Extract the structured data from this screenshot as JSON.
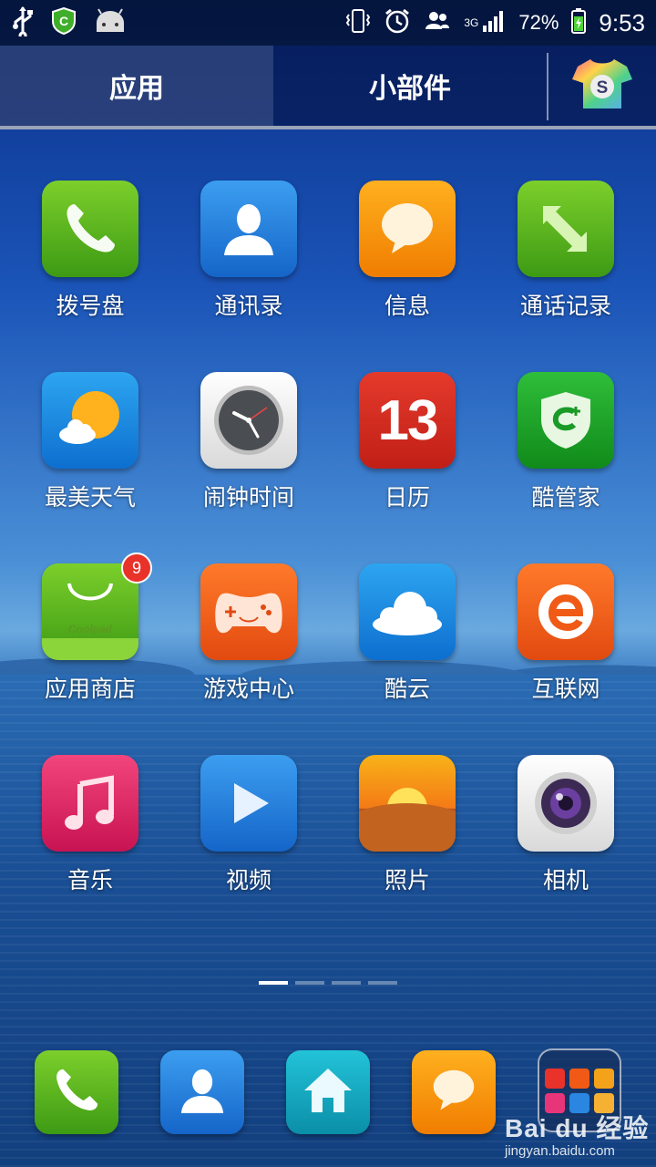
{
  "status_bar": {
    "network_type": "3G",
    "battery": "72%",
    "time": "9:53",
    "icons": [
      "usb-icon",
      "security-shield-icon",
      "android-icon",
      "vibrate-icon",
      "alarm-icon",
      "contacts-sync-icon",
      "signal-icon",
      "battery-icon"
    ]
  },
  "tabs": [
    {
      "label": "应用",
      "active": true
    },
    {
      "label": "小部件",
      "active": false
    }
  ],
  "theme_button": {
    "icon": "theme-shirt-icon",
    "letter": "S"
  },
  "apps": [
    {
      "label": "拨号盘",
      "icon": "phone-icon"
    },
    {
      "label": "通讯录",
      "icon": "contacts-icon"
    },
    {
      "label": "信息",
      "icon": "message-icon"
    },
    {
      "label": "通话记录",
      "icon": "call-log-icon"
    },
    {
      "label": "最美天气",
      "icon": "weather-icon"
    },
    {
      "label": "闹钟时间",
      "icon": "clock-icon"
    },
    {
      "label": "日历",
      "icon": "calendar-icon",
      "day": "13"
    },
    {
      "label": "酷管家",
      "icon": "security-icon"
    },
    {
      "label": "应用商店",
      "icon": "app-store-icon",
      "badge": "9",
      "brand": "Coolpad"
    },
    {
      "label": "游戏中心",
      "icon": "gamepad-icon"
    },
    {
      "label": "酷云",
      "icon": "cloud-icon"
    },
    {
      "label": "互联网",
      "icon": "browser-icon"
    },
    {
      "label": "音乐",
      "icon": "music-icon"
    },
    {
      "label": "视频",
      "icon": "video-play-icon"
    },
    {
      "label": "照片",
      "icon": "photos-icon"
    },
    {
      "label": "相机",
      "icon": "camera-icon"
    }
  ],
  "pager": {
    "pages": 4,
    "current": 1
  },
  "dock": {
    "items": [
      "phone-icon",
      "contacts-icon",
      "home-icon",
      "message-icon",
      "folder-icon"
    ]
  },
  "watermark": {
    "logo": "Bai du 经验",
    "url": "jingyan.baidu.com"
  },
  "colors": {
    "accent_green": "#3d9a14",
    "accent_blue": "#1565c8",
    "accent_orange": "#f07d00",
    "badge_red": "#e8322a"
  }
}
